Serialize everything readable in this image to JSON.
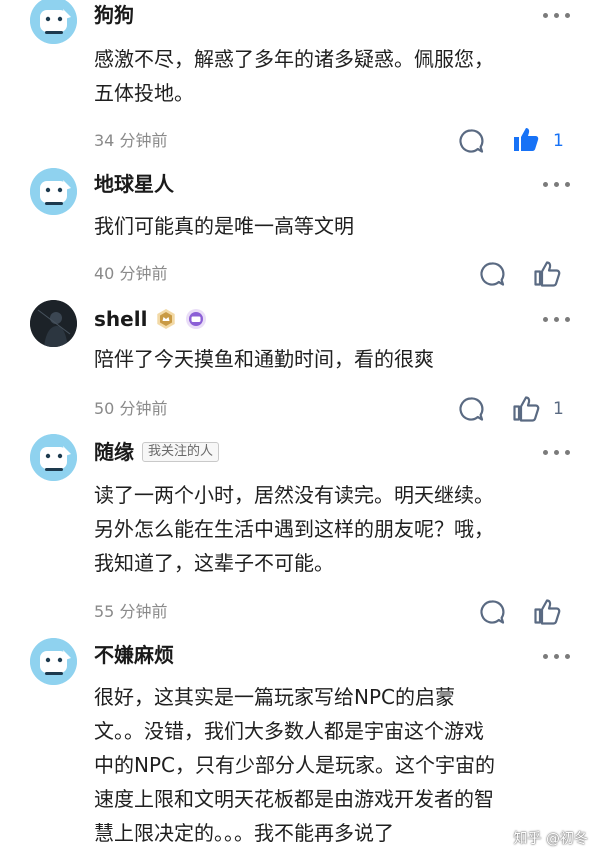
{
  "comments": [
    {
      "author": "狗狗",
      "text": "感激不尽，解惑了多年的诸多疑惑。佩服您，\n五体投地。",
      "time": "34 分钟前",
      "likes": "1",
      "liked": true,
      "avatar_icon": "dog-avatar-icon"
    },
    {
      "author": "地球星人",
      "text": "我们可能真的是唯一高等文明",
      "time": "40 分钟前",
      "likes": "",
      "liked": false,
      "avatar_icon": "dog-avatar-icon"
    },
    {
      "author": "shell",
      "text": "陪伴了今天摸鱼和通勤时间，看的很爽",
      "time": "50 分钟前",
      "likes": "1",
      "liked": false,
      "avatar_icon": "dark-portrait-avatar-icon"
    },
    {
      "author": "随缘",
      "tag": "我关注的人",
      "text": "读了一两个小时，居然没有读完。明天继续。\n另外怎么能在生活中遇到这样的朋友呢？哦，\n我知道了，这辈子不可能。",
      "time": "55 分钟前",
      "likes": "",
      "liked": false,
      "avatar_icon": "dog-avatar-icon"
    },
    {
      "author": "不嫌麻烦",
      "text": "很好，这其实是一篇玩家写给NPC的启蒙\n文。。没错，我们大多数人都是宇宙这个游戏\n中的NPC，只有少部分人是玩家。这个宇宙的\n速度上限和文明天花板都是由游戏开发者的智\n慧上限决定的。。。我不能再多说了",
      "avatar_icon": "dog-avatar-icon"
    }
  ],
  "watermark": "知乎 @初冬",
  "colors": {
    "accent": "#1772f6",
    "muted": "#8a8a8a",
    "icon": "#5a6a82"
  }
}
